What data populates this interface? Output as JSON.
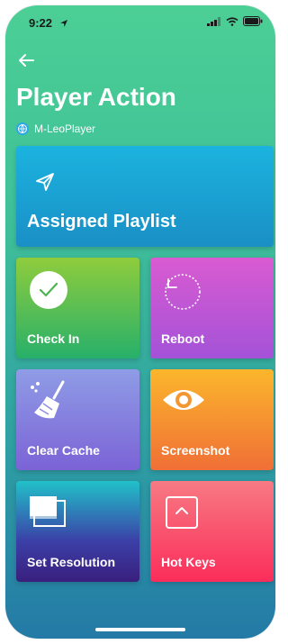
{
  "status": {
    "time": "9:22"
  },
  "header": {
    "title": "Player Action",
    "player_name": "M-LeoPlayer"
  },
  "actions": {
    "assigned": "Assigned Playlist",
    "checkin": "Check In",
    "reboot": "Reboot",
    "clearcache": "Clear Cache",
    "screenshot": "Screenshot",
    "resolution": "Set Resolution",
    "hotkeys": "Hot Keys"
  },
  "icons": {
    "back": "arrow-left-icon",
    "globe": "globe-icon",
    "send": "send-icon",
    "check": "check-circle-icon",
    "reboot": "refresh-circle-icon",
    "broom": "broom-icon",
    "eye": "eye-icon",
    "resolution": "resolution-icon",
    "hotkeys": "caret-up-square-icon"
  }
}
